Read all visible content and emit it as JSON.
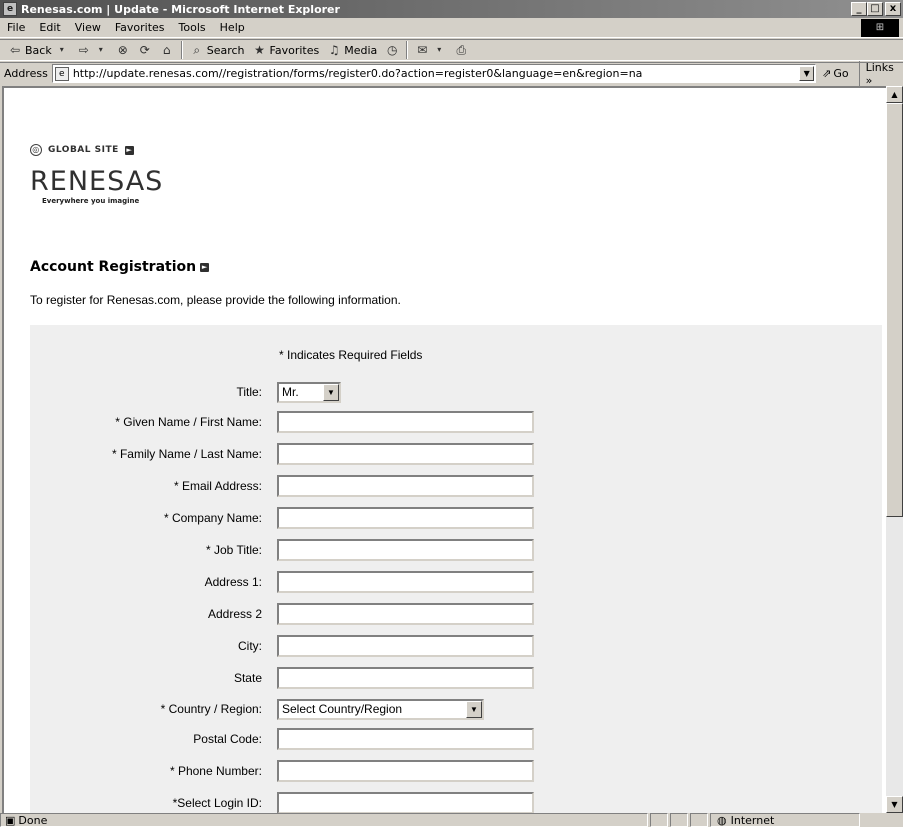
{
  "window": {
    "title": "Renesas.com | Update - Microsoft Internet Explorer",
    "minimize": "_",
    "maximize": "□",
    "close": "x"
  },
  "menu": [
    "File",
    "Edit",
    "View",
    "Favorites",
    "Tools",
    "Help"
  ],
  "toolbar": {
    "back": "Back",
    "search": "Search",
    "favorites": "Favorites",
    "media": "Media"
  },
  "address": {
    "label": "Address",
    "url": "http://update.renesas.com//registration/forms/register0.do?action=register0&language=en&region=na",
    "go": "Go",
    "links": "Links »"
  },
  "page": {
    "global_site": "GLOBAL SITE",
    "logo": "RENESAS",
    "tagline": "Everywhere you imagine",
    "section_title": "Account Registration",
    "intro": "To register for Renesas.com, please provide the following information.",
    "required_note": "* Indicates Required Fields",
    "fields": [
      {
        "label": "Title:",
        "type": "select",
        "value": "Mr."
      },
      {
        "label": "* Given Name / First Name:",
        "type": "text",
        "value": ""
      },
      {
        "label": "* Family Name / Last Name:",
        "type": "text",
        "value": ""
      },
      {
        "label": "* Email Address:",
        "type": "text",
        "value": ""
      },
      {
        "label": "* Company Name:",
        "type": "text",
        "value": ""
      },
      {
        "label": "* Job Title:",
        "type": "text",
        "value": ""
      },
      {
        "label": "Address 1:",
        "type": "text",
        "value": ""
      },
      {
        "label": "Address 2",
        "type": "text",
        "value": ""
      },
      {
        "label": "City:",
        "type": "text",
        "value": ""
      },
      {
        "label": "State",
        "type": "text",
        "value": ""
      },
      {
        "label": "* Country / Region:",
        "type": "select",
        "value": "Select Country/Region"
      },
      {
        "label": "Postal Code:",
        "type": "text",
        "value": ""
      },
      {
        "label": "* Phone Number:",
        "type": "text",
        "value": ""
      },
      {
        "label": "*Select Login ID:",
        "type": "text",
        "value": ""
      }
    ]
  },
  "status": {
    "text": "Done",
    "zone": "Internet"
  }
}
